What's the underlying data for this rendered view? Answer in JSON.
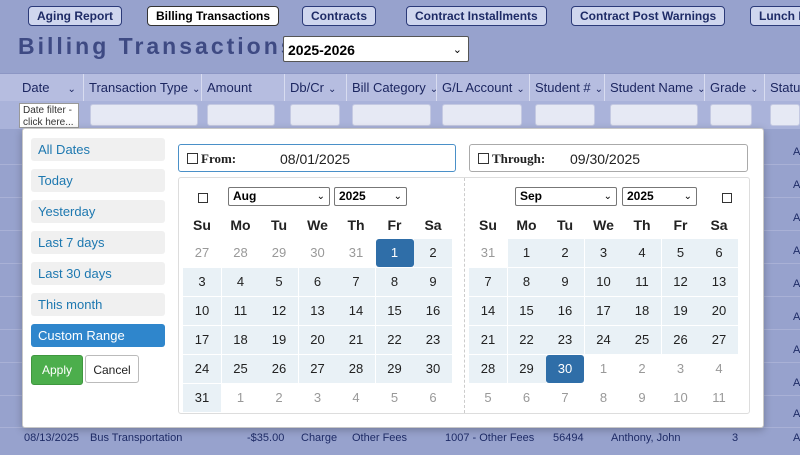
{
  "tabs": [
    "Aging Report",
    "Billing Transactions",
    "Contracts",
    "Contract Installments",
    "Contract Post Warnings",
    "Lunch P"
  ],
  "page_title": "Billing Transactions",
  "year_select": "2025-2026",
  "columns": [
    "Date",
    "Transaction Type",
    "Amount",
    "Db/Cr",
    "Bill Category",
    "G/L Account",
    "Student #",
    "Student Name",
    "Grade",
    "Status"
  ],
  "date_filter_hint": "Date filter - click here...",
  "ranges": [
    "All Dates",
    "Today",
    "Yesterday",
    "Last 7 days",
    "Last 30 days",
    "This month",
    "Custom Range"
  ],
  "active_range": "Custom Range",
  "apply_label": "Apply",
  "cancel_label": "Cancel",
  "from_label": "From:",
  "from_value": "08/01/2025",
  "through_label": "Through:",
  "through_value": "09/30/2025",
  "dow": [
    "Su",
    "Mo",
    "Tu",
    "We",
    "Th",
    "Fr",
    "Sa"
  ],
  "left_cal": {
    "month": "Aug",
    "year": "2025",
    "weeks": [
      [
        "27",
        "28",
        "29",
        "30",
        "31",
        "1",
        "2"
      ],
      [
        "3",
        "4",
        "5",
        "6",
        "7",
        "8",
        "9"
      ],
      [
        "10",
        "11",
        "12",
        "13",
        "14",
        "15",
        "16"
      ],
      [
        "17",
        "18",
        "19",
        "20",
        "21",
        "22",
        "23"
      ],
      [
        "24",
        "25",
        "26",
        "27",
        "28",
        "29",
        "30"
      ],
      [
        "31",
        "1",
        "2",
        "3",
        "4",
        "5",
        "6"
      ]
    ]
  },
  "right_cal": {
    "month": "Sep",
    "year": "2025",
    "weeks": [
      [
        "31",
        "1",
        "2",
        "3",
        "4",
        "5",
        "6"
      ],
      [
        "7",
        "8",
        "9",
        "10",
        "11",
        "12",
        "13"
      ],
      [
        "14",
        "15",
        "16",
        "17",
        "18",
        "19",
        "20"
      ],
      [
        "21",
        "22",
        "23",
        "24",
        "25",
        "26",
        "27"
      ],
      [
        "28",
        "29",
        "30",
        "1",
        "2",
        "3",
        "4"
      ],
      [
        "5",
        "6",
        "7",
        "8",
        "9",
        "10",
        "11"
      ]
    ]
  },
  "visible_row": {
    "date": "08/13/2025",
    "type": "Bus Transportation",
    "amount": "-$35.00",
    "dbcr": "Charge",
    "category": "Other Fees",
    "gl": "1007 - Other Fees",
    "student_no": "56494",
    "student_name": "Anthony, John",
    "grade": "3"
  },
  "right_edge_letter": "A",
  "colors": {
    "page_bg": "#97a2cd",
    "selected_day": "#2f6ea8",
    "active_range": "#2f86cc",
    "apply": "#4cae4c"
  }
}
